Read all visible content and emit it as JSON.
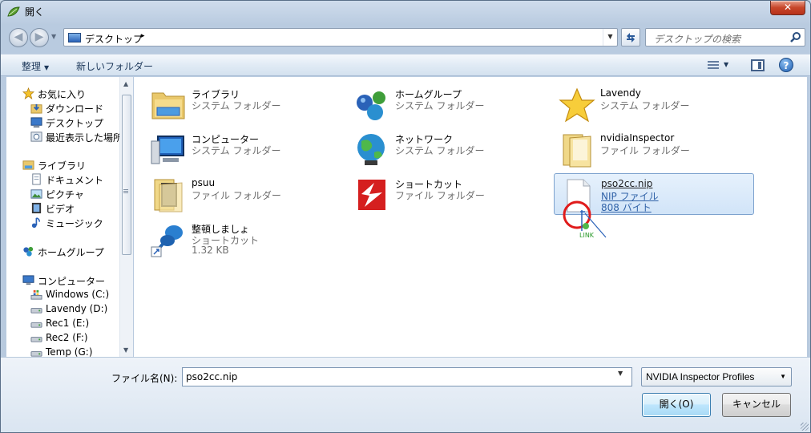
{
  "window": {
    "title": "開く",
    "close_label": "✕"
  },
  "address": {
    "crumb": "デスクトップ",
    "crumb_arrow": "▸",
    "search_placeholder": "デスクトップの検索"
  },
  "toolbar": {
    "organize_label": "整理",
    "new_folder_label": "新しいフォルダー",
    "help_label": "?"
  },
  "nav_pane": {
    "items": [
      {
        "label": "お気に入り",
        "icon": "star-icon"
      },
      {
        "label": "ダウンロード",
        "icon": "download-folder-icon"
      },
      {
        "label": "デスクトップ",
        "icon": "desktop-icon"
      },
      {
        "label": "最近表示した場所",
        "icon": "recent-places-icon"
      },
      {
        "label": "ライブラリ",
        "icon": "library-icon"
      },
      {
        "label": "ドキュメント",
        "icon": "document-icon"
      },
      {
        "label": "ピクチャ",
        "icon": "picture-icon"
      },
      {
        "label": "ビデオ",
        "icon": "video-icon"
      },
      {
        "label": "ミュージック",
        "icon": "music-icon"
      },
      {
        "label": "ホームグループ",
        "icon": "homegroup-icon"
      },
      {
        "label": "コンピューター",
        "icon": "computer-icon"
      },
      {
        "label": "Windows (C:)",
        "icon": "windows-drive-icon"
      },
      {
        "label": "Lavendy (D:)",
        "icon": "drive-icon"
      },
      {
        "label": "Rec1 (E:)",
        "icon": "drive-icon"
      },
      {
        "label": "Rec2 (F:)",
        "icon": "drive-icon"
      },
      {
        "label": "Temp (G:)",
        "icon": "drive-icon"
      }
    ]
  },
  "files": [
    {
      "name": "ライブラリ",
      "type": "システム フォルダー",
      "icon": "library-folder-icon"
    },
    {
      "name": "ホームグループ",
      "type": "システム フォルダー",
      "icon": "homegroup-icon"
    },
    {
      "name": "Lavendy",
      "type": "システム フォルダー",
      "icon": "star-icon"
    },
    {
      "name": "コンピューター",
      "type": "システム フォルダー",
      "icon": "computer-icon"
    },
    {
      "name": "ネットワーク",
      "type": "システム フォルダー",
      "icon": "network-globe-icon"
    },
    {
      "name": "nvidiaInspector",
      "type": "ファイル フォルダー",
      "icon": "folder-icon"
    },
    {
      "name": "psuu",
      "type": "ファイル フォルダー",
      "icon": "folder-icon"
    },
    {
      "name": "ショートカット",
      "type": "ファイル フォルダー",
      "icon": "mirrors-edge-folder-icon"
    },
    {
      "name": "pso2cc.nip",
      "type": "NIP ファイル",
      "size": "808 バイト",
      "icon": "file-icon"
    },
    {
      "name": "整頓しましょ",
      "type": "ショートカット",
      "size": "1.32 KB",
      "icon": "pushpin-shortcut-icon"
    }
  ],
  "drag_cursor_label": "LINK",
  "bottom": {
    "filename_label": "ファイル名(N):",
    "filename_value": "pso2cc.nip",
    "filetype_value": "NVIDIA Inspector Profiles",
    "open_label": "開く(O)",
    "cancel_label": "キャンセル"
  },
  "colors": {
    "accent": "#3c7fb1",
    "selection": "#d1e4f8",
    "secondary_text": "#6d6d6d"
  }
}
